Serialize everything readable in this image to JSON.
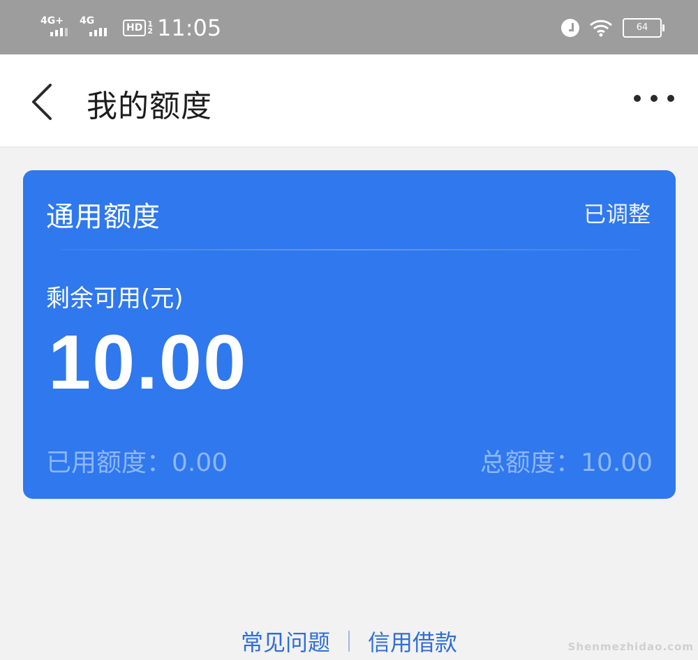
{
  "status_bar": {
    "network1": "4G+",
    "network2": "4G",
    "hd": "HD",
    "hd_sub1": "1",
    "hd_sub2": "2",
    "time": "11:05",
    "battery": "64"
  },
  "header": {
    "title": "我的额度"
  },
  "card": {
    "title": "通用额度",
    "status": "已调整",
    "available_label": "剩余可用(元)",
    "available_amount": "10.00",
    "used_label": "已用额度：",
    "used_value": "0.00",
    "total_label": "总额度：",
    "total_value": "10.00",
    "bg_color": "#2f78ee"
  },
  "footer": {
    "faq_link": "常见问题",
    "loan_link": "信用借款"
  },
  "watermark": "Shenmezhidao.com"
}
